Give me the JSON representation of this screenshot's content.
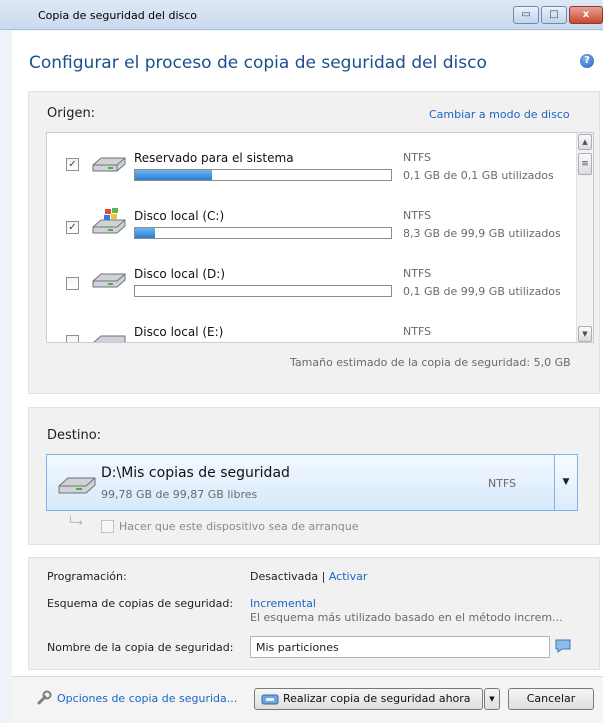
{
  "window": {
    "title": "Copia de seguridad del disco",
    "min_glyph": "▭",
    "max_glyph": "□",
    "close_glyph": "x"
  },
  "header": {
    "title": "Configurar el proceso de copia de seguridad del disco",
    "help_glyph": "?"
  },
  "source": {
    "label": "Origen:",
    "switch_link": "Cambiar a modo de disco",
    "disks": [
      {
        "checked": true,
        "name": "Reservado para el sistema",
        "fs": "NTFS",
        "usage": "0,1 GB de 0,1 GB utilizados",
        "fill": 0.3,
        "icon": "hdd-icon"
      },
      {
        "checked": true,
        "name": "Disco local (C:)",
        "fs": "NTFS",
        "usage": "8,3 GB de 99,9 GB utilizados",
        "fill": 0.08,
        "icon": "windows-drive-icon"
      },
      {
        "checked": false,
        "name": "Disco local (D:)",
        "fs": "NTFS",
        "usage": "0,1 GB de 99,9 GB utilizados",
        "fill": 0.0,
        "icon": "hdd-icon"
      },
      {
        "checked": false,
        "name": "Disco local (E:)",
        "fs": "NTFS",
        "usage": "",
        "fill": 0.0,
        "icon": "hdd-icon"
      }
    ],
    "estimate": "Tamaño estimado de la copia de seguridad: 5,0 GB",
    "scroll_up": "▲",
    "scroll_down": "▼",
    "scroll_grip": "≡",
    "check_glyph": "✓"
  },
  "destination": {
    "label": "Destino:",
    "path": "D:\\Mis copias de seguridad",
    "free": "99,78 GB de 99,87 GB libres",
    "fs": "NTFS",
    "dropdown_glyph": "▼",
    "boot_label": "Hacer que este dispositivo sea de arranque",
    "connector_glyph": "└→"
  },
  "settings": {
    "schedule_label": "Programación:",
    "schedule_value": "Desactivada",
    "schedule_separator": "|",
    "schedule_link": "Activar",
    "scheme_label": "Esquema de copias de seguridad:",
    "scheme_value": "Incremental",
    "scheme_desc": "El esquema más utilizado basado en el método increm...",
    "name_label": "Nombre de la copia de seguridad:",
    "name_value": "Mis particiones"
  },
  "footer": {
    "options_link": "Opciones de copia de segurida...",
    "run_button": "Realizar copia de seguridad ahora",
    "run_dropdown": "▼",
    "cancel_button": "Cancelar"
  }
}
